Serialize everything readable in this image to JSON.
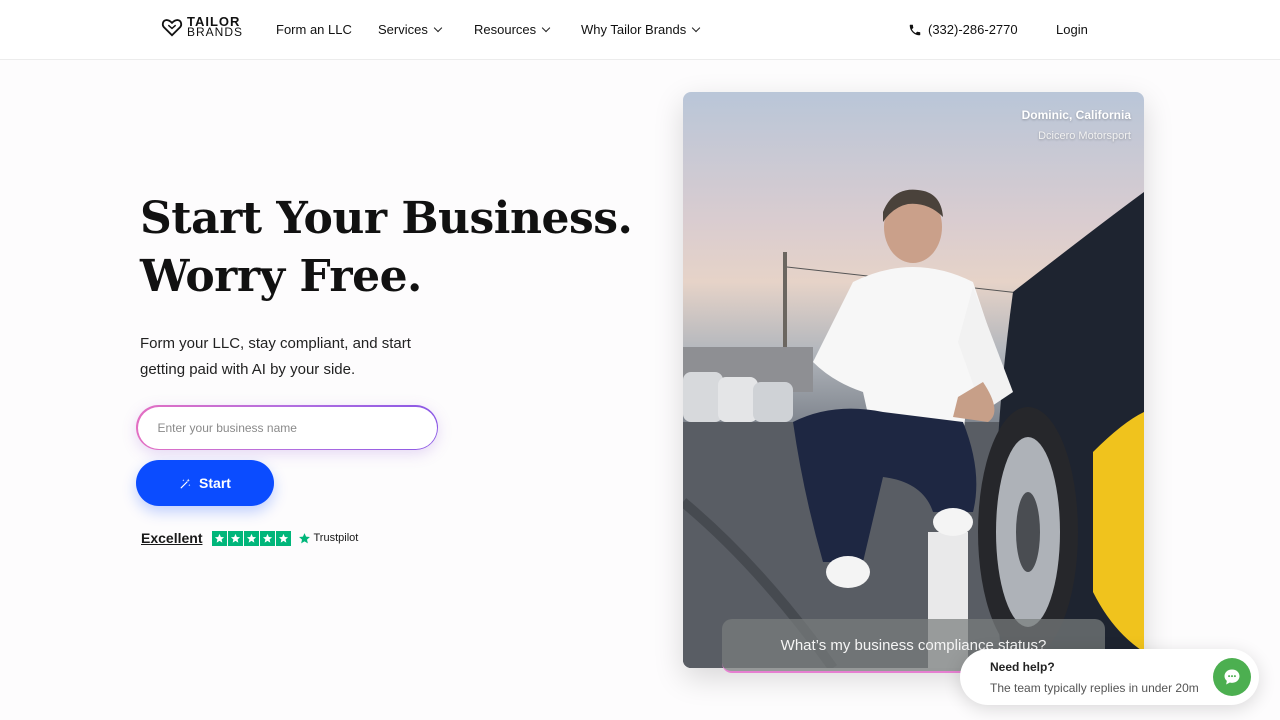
{
  "header": {
    "logo_line1": "TAILOR",
    "logo_line2": "BRANDS",
    "nav": [
      {
        "label": "Form an LLC",
        "has_dropdown": false
      },
      {
        "label": "Services",
        "has_dropdown": true
      },
      {
        "label": "Resources",
        "has_dropdown": true
      },
      {
        "label": "Why Tailor Brands",
        "has_dropdown": true
      }
    ],
    "phone": "(332)-286-2770",
    "login": "Login"
  },
  "hero": {
    "headline_line1": "Start Your Business.",
    "headline_line2": "Worry Free.",
    "subtitle": "Form your LLC, stay compliant, and start getting paid with AI by your side.",
    "input_placeholder": "Enter your business name",
    "start_label": "Start",
    "trust_rating": "Excellent",
    "trust_stars": 5,
    "trust_brand": "Trustpilot"
  },
  "photo": {
    "caption_name": "Dominic, California",
    "caption_company": "Dcicero Motorsport",
    "prompt": "What’s my business compliance status?"
  },
  "chat": {
    "title": "Need help?",
    "subtitle": "The team typically replies in under 20m"
  },
  "colors": {
    "primary_button": "#0b4cff",
    "trustpilot_green": "#00b67a",
    "chat_green": "#4caf50",
    "input_gradient_start": "#e36fc2",
    "input_gradient_end": "#8b58e5"
  }
}
